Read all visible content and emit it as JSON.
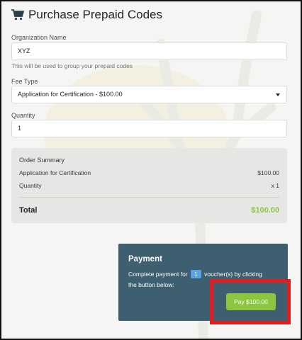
{
  "page": {
    "title": "Purchase Prepaid Codes",
    "title_icon": "shopping-cart-icon"
  },
  "form": {
    "organization": {
      "label": "Organization Name",
      "value": "XYZ",
      "help": "This will be used to group your prepaid codes"
    },
    "fee_type": {
      "label": "Fee Type",
      "value": "Application for Certification - $100.00"
    },
    "quantity": {
      "label": "Quantity",
      "value": "1"
    }
  },
  "summary": {
    "heading": "Order Summary",
    "item_label": "Application for Certification",
    "item_value": "$100.00",
    "quantity_label": "Quantity",
    "quantity_value": "x 1",
    "total_label": "Total",
    "total_value": "$100.00"
  },
  "payment": {
    "title": "Payment",
    "text_before": "Complete payment for",
    "quantity_badge": "1",
    "text_after": "voucher(s) by clicking",
    "text_line2": "the button below:",
    "button_label": "Pay $100.00"
  },
  "colors": {
    "accent_green": "#8cc63f",
    "payment_panel": "#3e5f6f",
    "badge_blue": "#5aa3e3",
    "highlight_red": "#e11d1d"
  }
}
